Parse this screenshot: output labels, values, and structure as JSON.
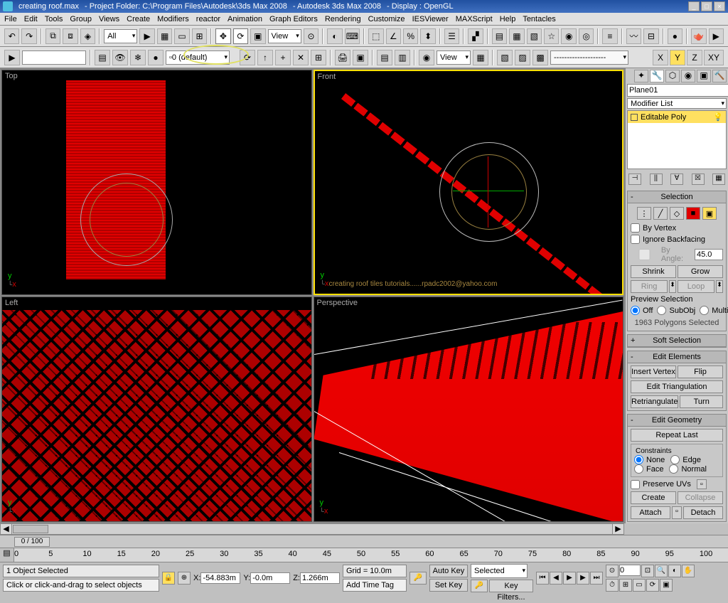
{
  "titlebar": {
    "file": "creating roof.max",
    "folder": "- Project Folder: C:\\Program Files\\Autodesk\\3ds Max 2008",
    "app": "- Autodesk 3ds Max 2008",
    "display": "- Display : OpenGL"
  },
  "menu": [
    "File",
    "Edit",
    "Tools",
    "Group",
    "Views",
    "Create",
    "Modifiers",
    "reactor",
    "Animation",
    "Graph Editors",
    "Rendering",
    "Customize",
    "IESViewer",
    "MAXScript",
    "Help",
    "Tentacles"
  ],
  "toolbar1": {
    "selset": "All",
    "refcoord": "View"
  },
  "toolbar2": {
    "layer": "0 (default)",
    "named_sel": "View"
  },
  "axisbtns": [
    "X",
    "Y",
    "Z",
    "XY"
  ],
  "viewports": {
    "top": "Top",
    "front": "Front",
    "left": "Left",
    "persp": "Perspective",
    "watermark": "creating roof tiles tutorials......rpadc2002@yahoo.com"
  },
  "panel": {
    "object_name": "Plane01",
    "modifier_list": "Modifier List",
    "stack_item": "Editable Poly",
    "selection": {
      "title": "Selection",
      "by_vertex": "By Vertex",
      "ignore_backfacing": "Ignore Backfacing",
      "by_angle": "By Angle:",
      "angle_val": "45.0",
      "shrink": "Shrink",
      "grow": "Grow",
      "ring": "Ring",
      "loop": "Loop",
      "preview": "Preview Selection",
      "off": "Off",
      "subobj": "SubObj",
      "multi": "Multi",
      "status": "1963 Polygons Selected"
    },
    "soft": "Soft Selection",
    "edit_elements": {
      "title": "Edit Elements",
      "insert_vertex": "Insert Vertex",
      "flip": "Flip",
      "edit_tri": "Edit Triangulation",
      "retri": "Retriangulate",
      "turn": "Turn"
    },
    "edit_geom": {
      "title": "Edit Geometry",
      "repeat": "Repeat Last",
      "constraints": "Constraints",
      "none": "None",
      "edge": "Edge",
      "face": "Face",
      "normal": "Normal",
      "preserve": "Preserve UVs",
      "create": "Create",
      "collapse": "Collapse",
      "attach": "Attach",
      "detach": "Detach"
    }
  },
  "timeline": {
    "pos": "0 / 100",
    "ticks": [
      0,
      5,
      10,
      15,
      20,
      25,
      30,
      35,
      40,
      45,
      50,
      55,
      60,
      65,
      70,
      75,
      80,
      85,
      90,
      95,
      100
    ]
  },
  "status": {
    "objsel": "1 Object Selected",
    "prompt": "Click or click-and-drag to select objects",
    "x": "-54.883m",
    "y": "-0.0m",
    "z": "1.266m",
    "grid": "Grid = 10.0m",
    "addtag": "Add Time Tag",
    "autokey": "Auto Key",
    "setkey": "Set Key",
    "selected": "Selected",
    "keyfilters": "Key Filters...",
    "frame": "0"
  }
}
